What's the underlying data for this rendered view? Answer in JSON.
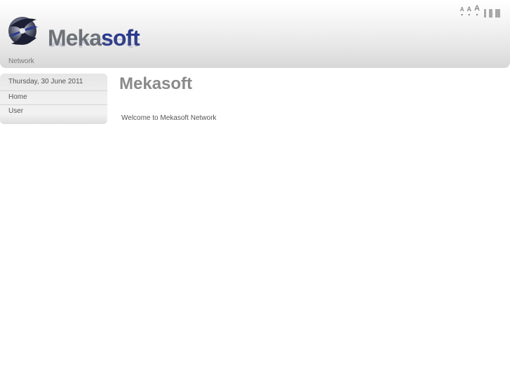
{
  "header": {
    "logo_part1": "Meka",
    "logo_part2": "soft",
    "nav_label": "Network",
    "size_controls": [
      {
        "glyph": "A",
        "name": "font-size-small-control"
      },
      {
        "glyph": "A",
        "name": "font-size-medium-control"
      },
      {
        "glyph": "A",
        "name": "font-size-large-control"
      }
    ]
  },
  "sidebar": {
    "date": "Thursday, 30 June 2011",
    "items": [
      {
        "label": "Home"
      },
      {
        "label": "User"
      }
    ]
  },
  "main": {
    "title": "Mekasoft",
    "welcome": "Welcome to Mekasoft Network"
  },
  "colors": {
    "logo_gray": "#6f7378",
    "logo_blue": "#2a3a8c",
    "title_gray": "#8a8a8a",
    "text_gray": "#555555"
  }
}
